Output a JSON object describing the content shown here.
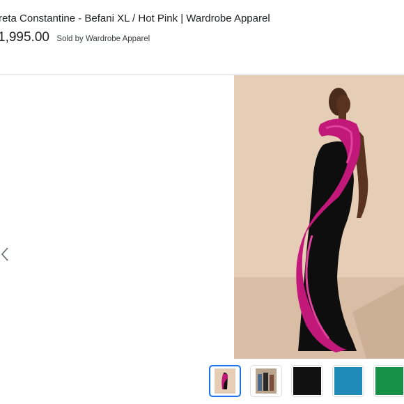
{
  "product": {
    "title": "reta Constantine - Befani XL / Hot Pink | Wardrobe Apparel",
    "price": "1,995.00",
    "seller": "Sold by Wardrobe Apparel"
  },
  "gallery": {
    "prev_icon": "chevron-left-icon",
    "main_image": "model-in-black-gown-with-hot-pink-ruffle",
    "thumbnails": [
      {
        "name": "model-in-black-gown-with-pink-ruffle",
        "selected": true
      },
      {
        "name": "model-group-photo",
        "selected": false
      },
      {
        "name": "black-fabric-swatch",
        "selected": false
      },
      {
        "name": "blue-fabric-swatch",
        "selected": false
      },
      {
        "name": "green-fabric-swatch",
        "selected": false
      }
    ]
  },
  "colors": {
    "wall": "#e6cdb6",
    "floor": "#d8bba2",
    "gown": "#0e0e0e",
    "ruffle": "#c2187a",
    "skin": "#5a3320",
    "swatch_black": "#111111",
    "swatch_blue": "#1e8ab7",
    "swatch_green": "#169146",
    "selected_border": "#1a73e8"
  }
}
